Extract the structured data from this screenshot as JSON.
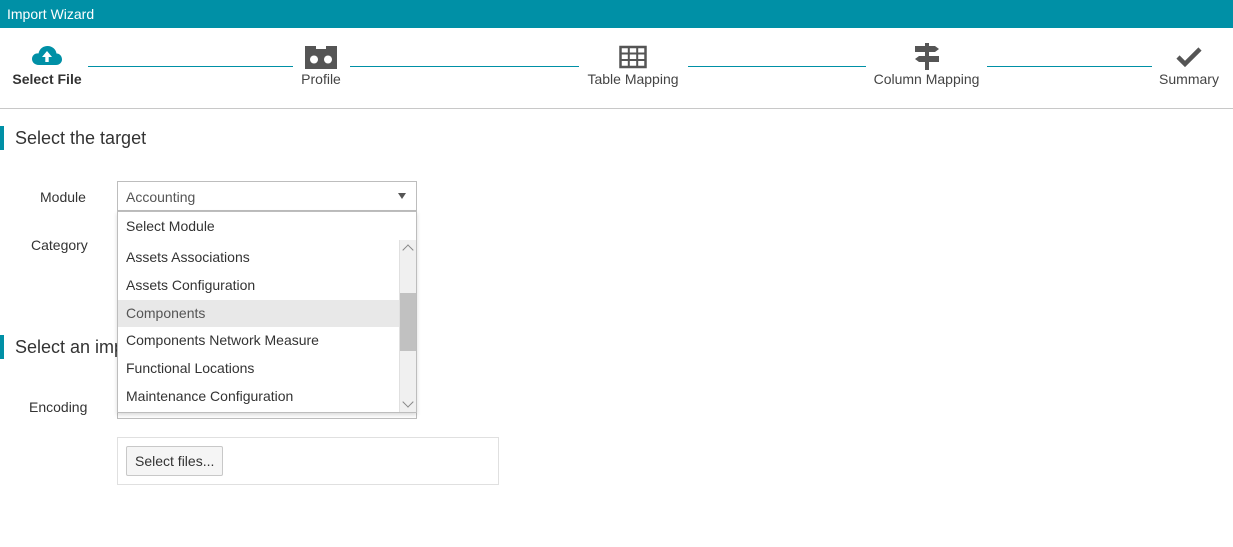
{
  "window": {
    "title": "Import Wizard"
  },
  "colors": {
    "accent": "#0090a6",
    "header_bg": "#0090a6"
  },
  "wizard": {
    "steps": [
      {
        "label": "Select File",
        "icon": "cloud-upload-icon",
        "active": true
      },
      {
        "label": "Profile",
        "icon": "profile-icon",
        "active": false
      },
      {
        "label": "Table Mapping",
        "icon": "table-icon",
        "active": false
      },
      {
        "label": "Column Mapping",
        "icon": "signpost-icon",
        "active": false
      },
      {
        "label": "Summary",
        "icon": "checkmark-icon",
        "active": false
      }
    ]
  },
  "target_section": {
    "title": "Select the target",
    "module_label": "Module",
    "module_value": "Accounting",
    "category_label": "Category"
  },
  "module_dropdown": {
    "header": "Select Module",
    "items": [
      "Assets Associations",
      "Assets Configuration",
      "Components",
      "Components Network Measure",
      "Functional Locations",
      "Maintenance Configuration"
    ],
    "highlighted": "Components"
  },
  "file_section": {
    "title": "Select an imp",
    "encoding_label": "Encoding",
    "select_files_label": "Select files..."
  }
}
